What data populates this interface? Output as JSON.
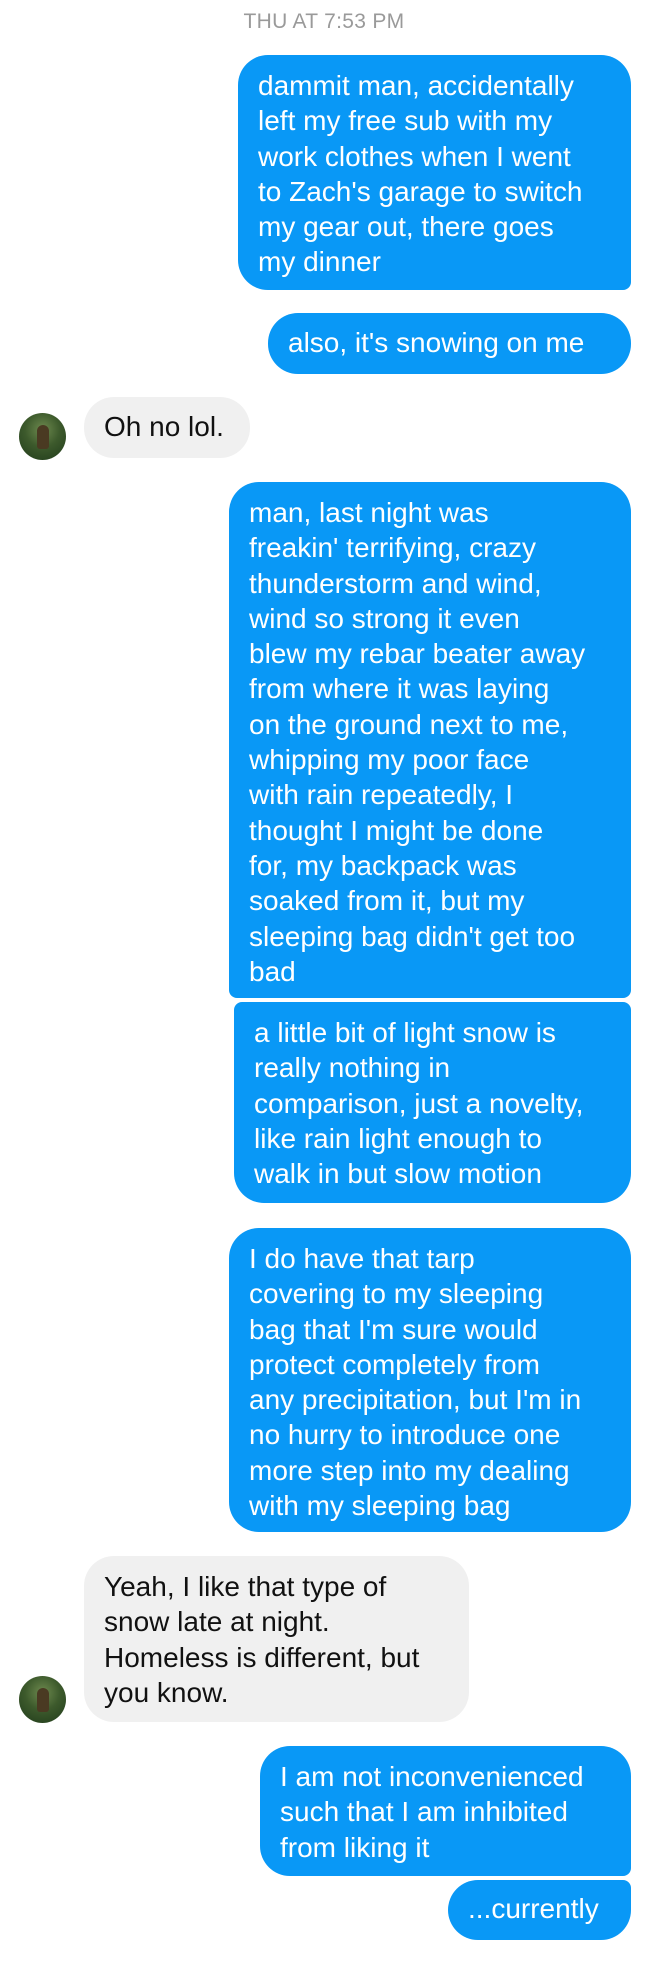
{
  "thread": {
    "timestamp": "THU AT 7:53 PM",
    "messages": [
      {
        "from": "me",
        "text": "dammit man, accidentally\nleft my free sub with my\nwork clothes when I went\nto Zach's garage to switch\nmy gear out, there goes\nmy dinner"
      },
      {
        "from": "me",
        "text": "also, it's snowing on me"
      },
      {
        "from": "them",
        "text": "Oh no lol."
      },
      {
        "from": "me",
        "text": "man, last night was\nfreakin' terrifying, crazy\nthunderstorm and wind,\nwind so strong it even\nblew my rebar beater away\nfrom where it was laying\non the ground next to me,\nwhipping my poor face\nwith rain repeatedly, I\nthought I might be done\nfor, my backpack was\nsoaked from it, but my\nsleeping bag didn't get too\nbad"
      },
      {
        "from": "me",
        "text": "a little bit of light snow is\nreally nothing in\ncomparison, just a novelty,\nlike rain light enough to\nwalk in but slow motion"
      },
      {
        "from": "me",
        "text": "I do have that tarp\ncovering to my sleeping\nbag that I'm sure would\nprotect completely from\nany precipitation, but I'm in\nno hurry to introduce one\nmore step into my dealing\nwith my sleeping bag"
      },
      {
        "from": "them",
        "text": "Yeah, I like that type of\nsnow late at night.\nHomeless is different, but\nyou know."
      },
      {
        "from": "me",
        "text": "I am not inconvenienced\nsuch that I am inhibited\nfrom liking it"
      },
      {
        "from": "me",
        "text": "...currently"
      }
    ]
  },
  "colors": {
    "outgoing_bubble": "#0998f6",
    "incoming_bubble": "#f0f0f0",
    "timestamp": "#9a9a9a"
  },
  "icons": {
    "avatar": "contact-avatar-photo"
  }
}
